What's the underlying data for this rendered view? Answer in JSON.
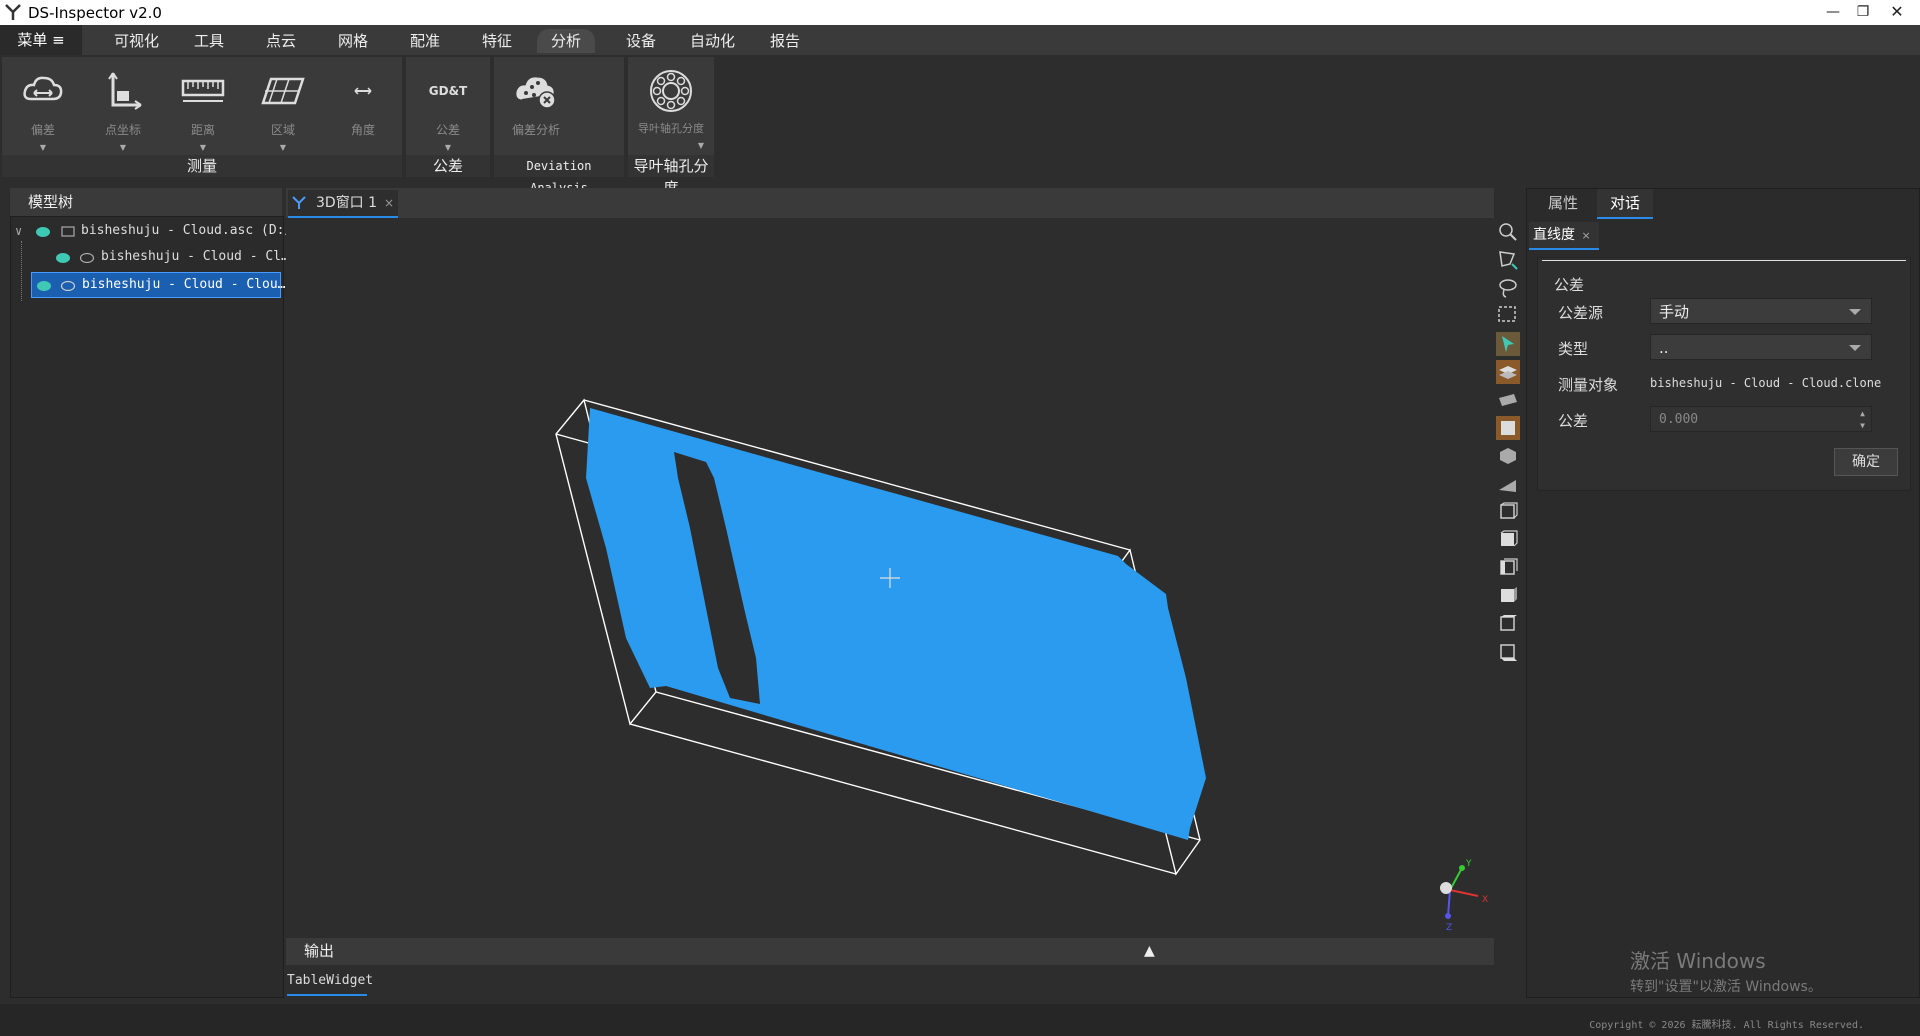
{
  "window": {
    "title": "DS-Inspector v2.0",
    "minimize_icon": "minimize-icon",
    "maximize_icon": "restore-icon",
    "close_icon": "close-icon"
  },
  "menu": {
    "main_label": "菜单 ≡",
    "items": [
      "可视化",
      "工具",
      "点云",
      "网格",
      "配准",
      "特征",
      "分析",
      "设备",
      "自动化",
      "报告"
    ],
    "active_item": "分析"
  },
  "ribbon": {
    "groups": [
      {
        "label": "测量",
        "buttons": [
          {
            "label": "偏差",
            "icon": "cloud-deviation-icon",
            "has_dropdown": true
          },
          {
            "label": "点坐标",
            "icon": "point-coordinate-icon",
            "has_dropdown": true
          },
          {
            "label": "距离",
            "icon": "ruler-icon",
            "has_dropdown": true
          },
          {
            "label": "区域",
            "icon": "area-icon",
            "has_dropdown": true
          },
          {
            "label": "角度",
            "icon": "angle-icon",
            "has_dropdown": false
          }
        ]
      },
      {
        "label": "公差",
        "buttons": [
          {
            "label": "公差",
            "icon": "gdt-icon",
            "icon_text": "GD&T",
            "has_dropdown": true
          }
        ]
      },
      {
        "label": "Deviation Analysis",
        "buttons": [
          {
            "label": "偏差分析",
            "icon": "deviation-analysis-icon",
            "has_dropdown": false
          }
        ]
      },
      {
        "label": "导叶轴孔分度",
        "buttons": [
          {
            "label": "导叶轴孔分度",
            "icon": "bearing-icon",
            "has_dropdown": true
          }
        ]
      }
    ]
  },
  "model_tree": {
    "title": "模型树",
    "items": [
      {
        "label": "bisheshuju - Cloud.asc (D:/)",
        "level": 0,
        "expanded": true,
        "selected": false
      },
      {
        "label": "bisheshuju - Cloud - Cl…",
        "level": 1,
        "selected": false
      },
      {
        "label": "bisheshuju - Cloud - Clou…",
        "level": 1,
        "selected": true
      }
    ]
  },
  "viewport": {
    "tab_label": "3D窗口 1",
    "tab_close": "×",
    "axis_labels": {
      "x": "X",
      "y": "Y",
      "z": "Z"
    },
    "cloud_color": "#2a9bef",
    "background_color": "#2d2d2d"
  },
  "side_toolbar": {
    "tools": [
      "zoom-select-icon",
      "polygon-select-icon",
      "lasso-select-icon",
      "rect-select-icon",
      "pointer-icon",
      "layer-icon",
      "plane-icon",
      "box-icon",
      "cube-front-icon",
      "perspective-icon",
      "view-front-icon",
      "view-back-icon",
      "view-left-icon",
      "view-right-icon",
      "view-top-icon",
      "view-bottom-icon"
    ]
  },
  "output": {
    "title": "输出",
    "tab_label": "TableWidget"
  },
  "right_panel": {
    "tabs": [
      "属性",
      "对话"
    ],
    "active_tab": "对话",
    "subtab_label": "直线度",
    "subtab_close": "×",
    "section_title": "公差",
    "fields": {
      "source_label": "公差源",
      "source_value": "手动",
      "type_label": "类型",
      "type_value": "..",
      "target_label": "测量对象",
      "target_value": "bisheshuju - Cloud - Cloud.clone",
      "tolerance_label": "公差",
      "tolerance_value": "0.000"
    },
    "confirm_label": "确定"
  },
  "watermark": {
    "line1": "激活 Windows",
    "line2": "转到\"设置\"以激活 Windows。"
  },
  "status": {
    "copyright": "Copyright © 2026 耘騰科技. All Rights Reserved."
  }
}
